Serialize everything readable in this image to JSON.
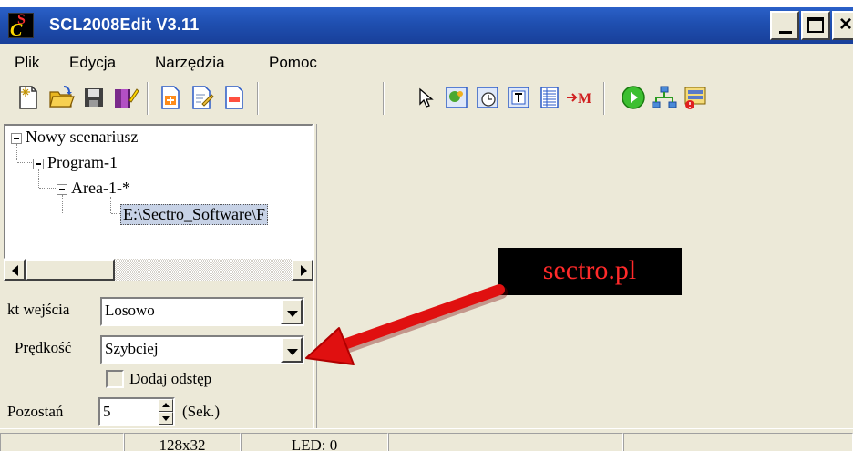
{
  "window": {
    "title": "SCL2008Edit V3.11",
    "icon_name": "app-logo-icon",
    "controls": [
      "minimize-icon",
      "maximize-icon",
      "close-icon"
    ]
  },
  "menu": {
    "items": [
      "Plik",
      "Edycja",
      "Narzędzia",
      "Pomoc"
    ]
  },
  "toolbar": {
    "buttons": [
      "new-file-icon",
      "open-folder-icon",
      "save-icon",
      "edit-book-icon",
      "add-program-icon",
      "edit-program-icon",
      "remove-program-icon",
      "select-pointer-icon",
      "image-icon",
      "clock-icon",
      "text-icon",
      "table-icon",
      "move-icon",
      "play-icon",
      "network-icon",
      "send-icon"
    ]
  },
  "tree": {
    "root": "Nowy scenariusz",
    "program": "Program-1",
    "area": "Area-1-*",
    "file": "E:\\Sectro_Software\\F"
  },
  "properties": {
    "entry_label": "kt wejścia",
    "entry_value": "Losowo",
    "speed_label": "Prędkość",
    "speed_value": "Szybciej",
    "gap_checkbox_label": "Dodaj odstęp",
    "stay_label": "Pozostań",
    "stay_value": "5",
    "stay_unit": "(Sek.)"
  },
  "watermark": "sectro.pl",
  "statusbar": {
    "resolution": "128x32",
    "led": "LED: 0"
  },
  "colors": {
    "titlebar": "#1f4fb0",
    "window_bg": "#ece9d8",
    "arrow": "#e01010",
    "watermark_text": "#ff2a2a"
  }
}
